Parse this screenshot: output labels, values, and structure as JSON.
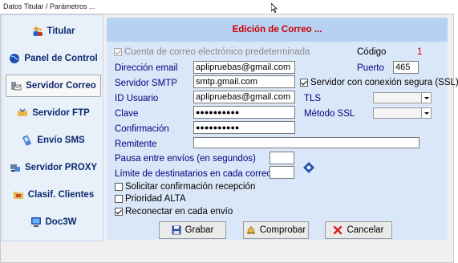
{
  "window": {
    "title": "Datos Titular / Parámetros ..."
  },
  "sidebar": {
    "items": [
      {
        "label": "Titular",
        "icon": "users-icon",
        "active": false
      },
      {
        "label": "Panel de Control",
        "icon": "globe-icon",
        "active": false
      },
      {
        "label": "Servidor Correo",
        "icon": "mail-server-icon",
        "active": true
      },
      {
        "label": "Servidor FTP",
        "icon": "ftp-icon",
        "active": false
      },
      {
        "label": "Envío SMS",
        "icon": "sms-icon",
        "active": false
      },
      {
        "label": "Servidor PROXY",
        "icon": "proxy-icon",
        "active": false
      },
      {
        "label": "Clasif. Clientes",
        "icon": "folder-icon",
        "active": false
      },
      {
        "label": "Doc3W",
        "icon": "monitor-icon",
        "active": false
      }
    ]
  },
  "panel": {
    "title": "Edición de Correo ...",
    "default_account_label": "Cuenta de correo electrónico predeterminada",
    "codigo_label": "Código",
    "codigo_value": "1",
    "email_label": "Dirección email",
    "email_value": "aplipruebas@gmail.com",
    "puerto_label": "Puerto",
    "puerto_value": "465",
    "smtp_label": "Servidor SMTP",
    "smtp_value": "smtp.gmail.com",
    "ssl_server_label": "Servidor con conexión segura (SSL)",
    "user_label": "ID Usuario",
    "user_value": "aplipruebas@gmail.com",
    "tls_label": "TLS",
    "tls_value": "",
    "clave_label": "Clave",
    "clave_value": "●●●●●●●●●●",
    "ssl_method_label": "Método SSL",
    "ssl_method_value": "",
    "confirm_label": "Confirmación",
    "confirm_value": "●●●●●●●●●●",
    "remitente_label": "Remitente",
    "remitente_value": "",
    "pausa_label": "Pausa entre envíos (en segundos)",
    "pausa_value": "",
    "limite_label": "Límite de destinatarios en cada correo",
    "limite_value": "",
    "solicitar_label": "Solicitar confirmación recepción",
    "prioridad_label": "Prioridad ALTA",
    "reconectar_label": "Reconectar en cada envío"
  },
  "buttons": {
    "grabar": "Grabar",
    "comprobar": "Comprobar",
    "cancelar": "Cancelar"
  }
}
